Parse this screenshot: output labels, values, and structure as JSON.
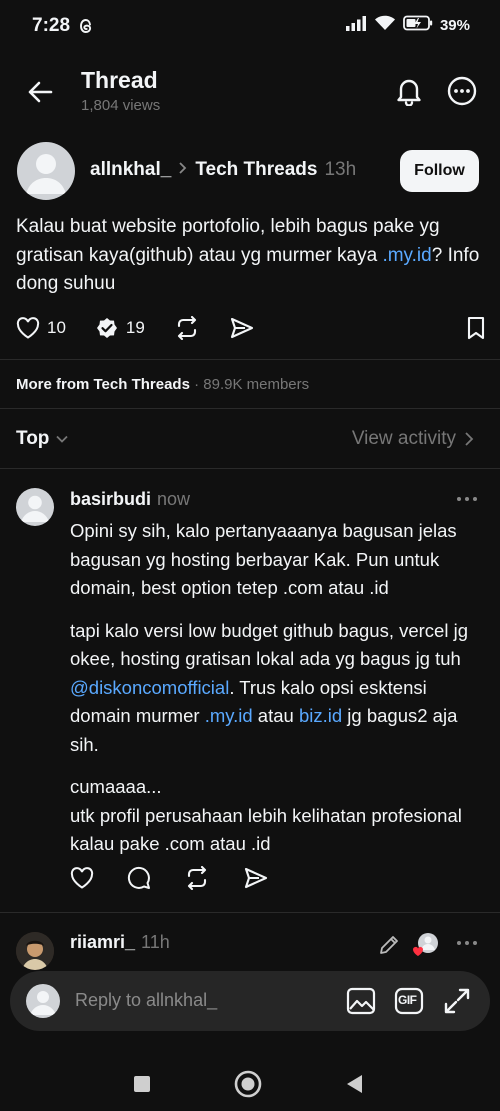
{
  "status_bar": {
    "time": "7:28",
    "battery": "39%"
  },
  "header": {
    "title": "Thread",
    "views": "1,804 views"
  },
  "post": {
    "username": "allnkhal_",
    "community": "Tech Threads",
    "time": "13h",
    "follow_label": "Follow",
    "body_before": "Kalau buat website portofolio,  lebih bagus pake yg gratisan kaya(github) atau yg murmer kaya ",
    "body_link": ".my.id",
    "body_after": "? Info dong suhuu",
    "likes": "10",
    "reposts": "19"
  },
  "community_info": {
    "more_from": "More from Tech Threads",
    "members": "· 89.9K members"
  },
  "sort": {
    "label": "Top",
    "view_activity": "View activity"
  },
  "reply1": {
    "username": "basirbudi",
    "time": "now",
    "p1": "Opini sy sih, kalo pertanyaaanya bagusan jelas bagusan yg hosting berbayar Kak. Pun untuk domain, best option tetep .com atau .id",
    "p2_a": "tapi kalo versi low budget github bagus, vercel jg okee, hosting gratisan lokal ada yg bagus jg tuh ",
    "p2_mention": "@diskoncomofficial",
    "p2_b": ". Trus kalo opsi esktensi domain murmer ",
    "p2_link1": ".my.id",
    "p2_c": " atau ",
    "p2_link2": "biz.id",
    "p2_d": " jg bagus2 aja sih.",
    "p3_line1": "cumaaaa...",
    "p3_line2": "utk profil perusahaan lebih kelihatan profesional kalau pake .com atau .id"
  },
  "reply2": {
    "username": "riiamri_",
    "time": "11h"
  },
  "composer": {
    "placeholder": "Reply to allnkhal_",
    "gif_label": "GIF"
  },
  "colors": {
    "background": "#101010",
    "link": "#5aa9ff",
    "muted": "#777777",
    "composer": "#262626"
  }
}
